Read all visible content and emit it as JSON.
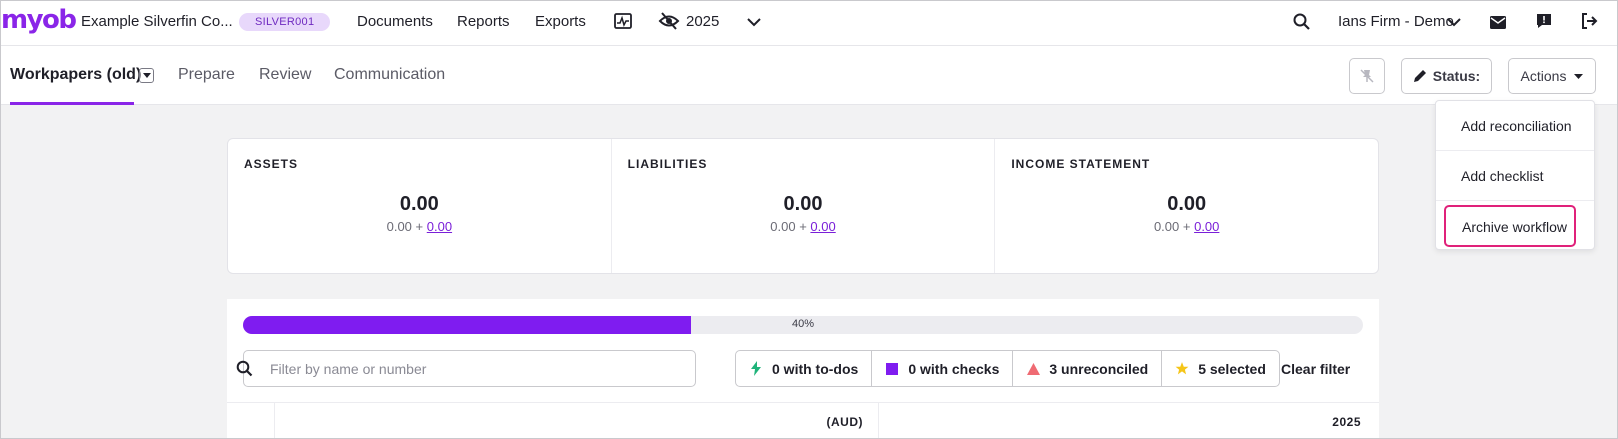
{
  "topbar": {
    "logo": "myob",
    "company": "Example Silverfin Co...",
    "company_code": "SILVER001",
    "nav": {
      "documents": "Documents",
      "reports": "Reports",
      "exports": "Exports"
    },
    "year": "2025",
    "firm": "Ians Firm - Demo",
    "icons": [
      "monitor-chart-icon",
      "eye-slash-icon",
      "chevron-down-icon",
      "search-icon",
      "mail-icon",
      "chat-icon",
      "logout-icon"
    ]
  },
  "tabs": {
    "active": "Workpapers (old)",
    "prepare": "Prepare",
    "review": "Review",
    "communication": "Communication"
  },
  "toolbar": {
    "status_label": "Status:",
    "actions_label": "Actions"
  },
  "actions_menu": {
    "items": [
      "Add reconciliation",
      "Add checklist",
      "Archive workflow"
    ]
  },
  "summary": [
    {
      "title": "ASSETS",
      "total": "0.00",
      "base": "0.00 +",
      "adjust": "0.00"
    },
    {
      "title": "LIABILITIES",
      "total": "0.00",
      "base": "0.00 +",
      "adjust": "0.00"
    },
    {
      "title": "INCOME STATEMENT",
      "total": "0.00",
      "base": "0.00 +",
      "adjust": "0.00"
    }
  ],
  "progress": {
    "value": 0.4,
    "label": "40%"
  },
  "filter": {
    "placeholder": "Filter by name or number",
    "chips": [
      {
        "label": "0 with to-dos",
        "icon": "bolt-icon",
        "color": "#1fb37a"
      },
      {
        "label": "0 with checks",
        "icon": "square-icon",
        "color": "#7f1cf0"
      },
      {
        "label": "3 unreconciled",
        "icon": "triangle-icon",
        "color": "#ef6b73"
      },
      {
        "label": "5 selected",
        "icon": "star-icon",
        "color": "#f5c518"
      }
    ],
    "clear": "Clear filter"
  },
  "table": {
    "currency": "(AUD)",
    "year": "2025"
  },
  "colors": {
    "brand": "#8a25e8",
    "progress": "#7f1cf0",
    "highlight": "#e0217a",
    "link": "#7a1fd8"
  }
}
